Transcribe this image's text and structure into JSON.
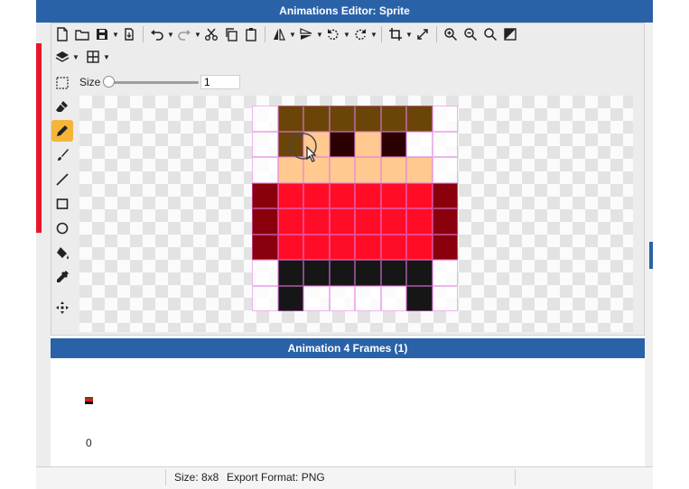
{
  "window": {
    "title": "Animations Editor: Sprite"
  },
  "toolbar": {
    "icons": [
      "new-file",
      "open-folder",
      "save",
      "export",
      "undo",
      "redo",
      "cut",
      "copy",
      "paste",
      "flip-horizontal",
      "flip-vertical",
      "rotate-ccw",
      "rotate-cw",
      "crop",
      "resize",
      "zoom-in",
      "zoom-out",
      "zoom-fit",
      "invert"
    ]
  },
  "size_control": {
    "label": "Size",
    "value": "1"
  },
  "tools": [
    "eraser",
    "pencil",
    "brush",
    "line",
    "rectangle",
    "ellipse",
    "fill",
    "eyedropper",
    "move"
  ],
  "active_tool": "pencil",
  "sprite": {
    "palette": {
      "H": "#6b4508",
      "S": "#ffc98f",
      "E": "#2a0000",
      "R": "#ff0d26",
      "D": "#8a000c",
      "B": "#161616",
      "T": ""
    },
    "rows": [
      "THHHHHHT",
      "THSESETT",
      "TSSSSSST",
      "DRRRRRRD",
      "DRRRRRRD",
      "DRRRRRRD",
      "TBBBBBBT",
      "TBTTTTBT"
    ]
  },
  "animation_panel": {
    "title": "Animation 4 Frames (1)",
    "frame_index": "0"
  },
  "status": {
    "size": "Size: 8x8",
    "export_format": "Export Format: PNG"
  },
  "colors": {
    "accent": "#2a62a8",
    "active_tool": "#f5b53a",
    "grid": "#e178e1"
  }
}
